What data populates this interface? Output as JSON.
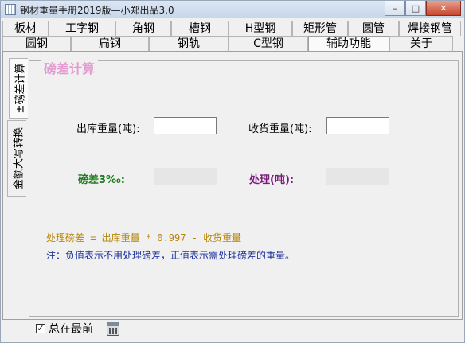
{
  "window": {
    "title": "钢材重量手册2019版—小郑出品3.0",
    "minimize": "–",
    "maximize": "□",
    "close": "✕"
  },
  "tabs_row1": [
    "板材",
    "工字钢",
    "角钢",
    "槽钢",
    "H型钢",
    "矩形管",
    "圆管",
    "焊接钢管"
  ],
  "tabs_row2": [
    "圆钢",
    "扁钢",
    "钢轨",
    "C型钢",
    "辅助功能",
    "关于"
  ],
  "active_tab": "辅助功能",
  "side_tabs": [
    "±磅差计算",
    "金额大写转换"
  ],
  "active_side_tab": "±磅差计算",
  "panel": {
    "title": "磅差计算",
    "outbound_label": "出库重量(吨):",
    "outbound_value": "",
    "received_label": "收货重量(吨):",
    "received_value": "",
    "diff_label": "磅差3‰:",
    "diff_value": "",
    "handle_label": "处理(吨):",
    "handle_value": "",
    "formula": "处理磅差 = 出库重量 * 0.997 - 收货重量",
    "note": "注：负值表示不用处理磅差，正值表示需处理磅差的重量。"
  },
  "footer": {
    "always_on_top_label": "总在最前",
    "always_on_top_checked": "✓"
  }
}
